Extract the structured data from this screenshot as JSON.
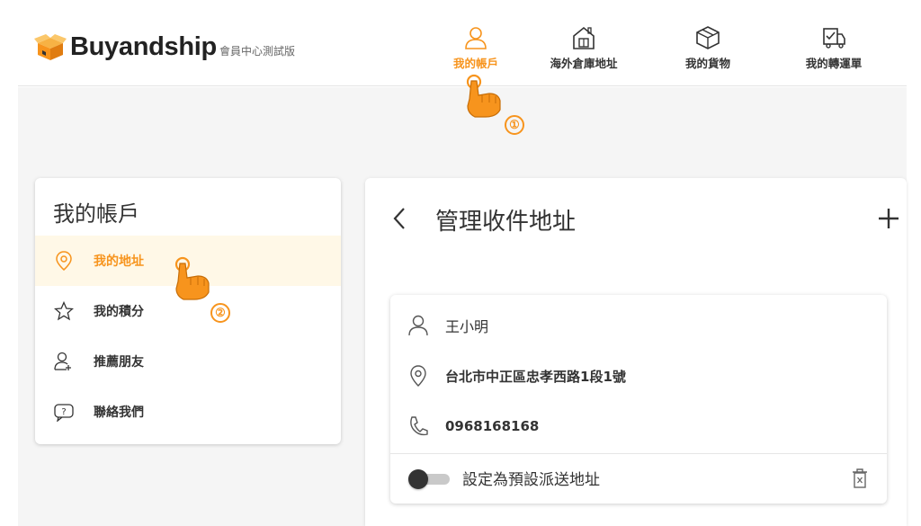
{
  "header": {
    "logo_text": "Buyandship",
    "subtitle": "會員中心測試版",
    "nav": [
      {
        "label": "我的帳戶",
        "icon": "user-icon",
        "active": true
      },
      {
        "label": "海外倉庫地址",
        "icon": "warehouse-icon",
        "active": false
      },
      {
        "label": "我的貨物",
        "icon": "box-icon",
        "active": false
      },
      {
        "label": "我的轉運單",
        "icon": "truck-checklist-icon",
        "active": false
      }
    ]
  },
  "sidebar": {
    "title": "我的帳戶",
    "items": [
      {
        "label": "我的地址",
        "icon": "location-pin-icon",
        "active": true
      },
      {
        "label": "我的積分",
        "icon": "star-icon",
        "active": false
      },
      {
        "label": "推薦朋友",
        "icon": "add-user-icon",
        "active": false
      },
      {
        "label": "聯絡我們",
        "icon": "chat-question-icon",
        "active": false
      }
    ]
  },
  "main": {
    "title": "管理收件地址",
    "address": {
      "name": "王小明",
      "address": "台北市中正區忠孝西路1段1號",
      "phone": "0968168168",
      "default_label": "設定為預設派送地址",
      "default_on": false
    }
  },
  "annotations": {
    "step1": "①",
    "step2": "②"
  },
  "colors": {
    "accent": "#f7941d",
    "active_bg": "#fff8e7",
    "page_bg": "#f5f5f5"
  }
}
